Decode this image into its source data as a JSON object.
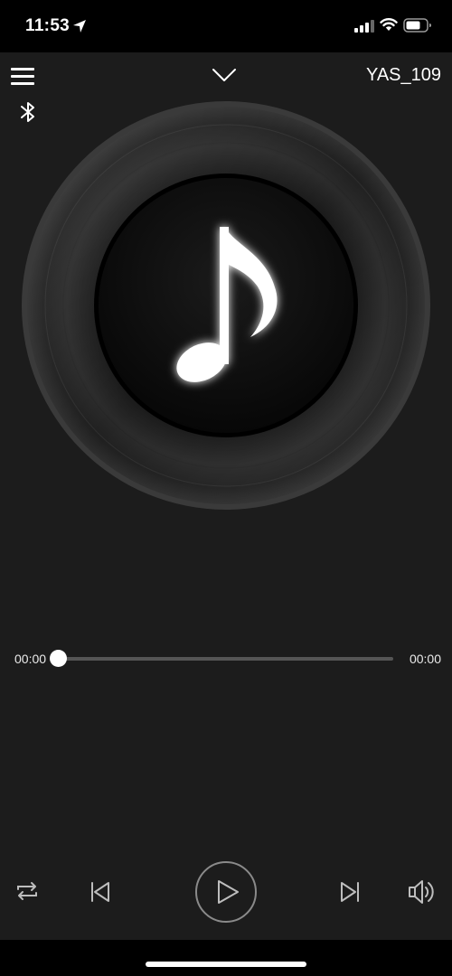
{
  "status_bar": {
    "time": "11:53"
  },
  "header": {
    "device_name": "YAS_109"
  },
  "player": {
    "current_time": "00:00",
    "total_time": "00:00",
    "progress": 0
  },
  "icons": {
    "menu": "hamburger-menu-icon",
    "collapse": "chevron-down-icon",
    "bluetooth": "bluetooth-icon",
    "artwork": "music-note-icon",
    "repeat": "repeat-icon",
    "previous": "skip-previous-icon",
    "play": "play-icon",
    "next": "skip-next-icon",
    "volume": "speaker-volume-icon"
  },
  "colors": {
    "background": "#1c1c1c",
    "status_bar": "#000000",
    "track": "#555555",
    "thumb": "#ffffff"
  }
}
